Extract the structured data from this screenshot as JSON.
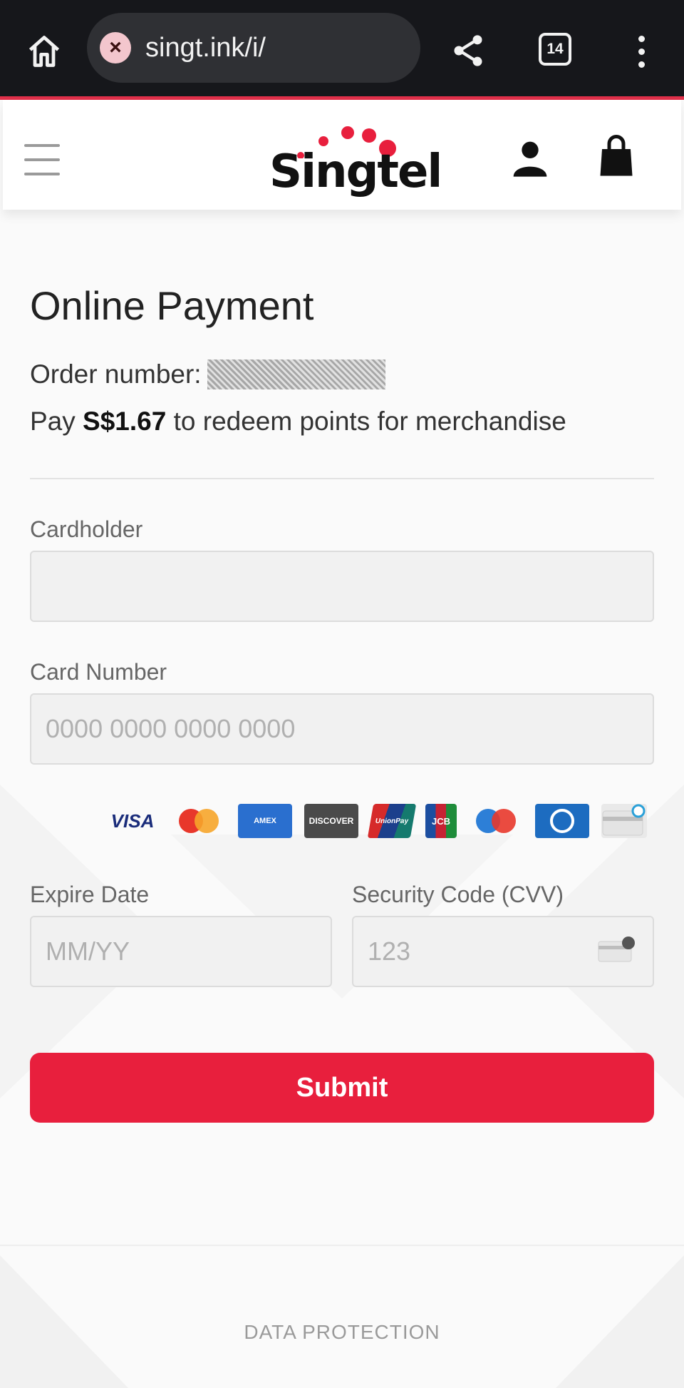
{
  "browser": {
    "url": "singt.ink/i/",
    "tab_count": "14"
  },
  "header": {
    "logo_text": "Singtel"
  },
  "page": {
    "title": "Online Payment",
    "order_label": "Order number:",
    "pay_prefix": "Pay ",
    "pay_amount": "S$1.67",
    "pay_suffix": " to redeem points for merchandise"
  },
  "form": {
    "cardholder_label": "Cardholder",
    "cardholder_placeholder": "",
    "card_number_label": "Card Number",
    "card_number_placeholder": "0000 0000 0000 0000",
    "expire_label": "Expire Date",
    "expire_placeholder": "MM/YY",
    "cvv_label": "Security Code (CVV)",
    "cvv_placeholder": "123",
    "submit_label": "Submit"
  },
  "card_brands": [
    "VISA",
    "Mastercard",
    "American Express",
    "DISCOVER",
    "UnionPay",
    "JCB",
    "Maestro",
    "Diners Club",
    "Generic Card"
  ],
  "footer": {
    "data_protection": "DATA PROTECTION"
  },
  "colors": {
    "brand_red": "#e81f3d",
    "chrome_bg": "#16171b"
  }
}
